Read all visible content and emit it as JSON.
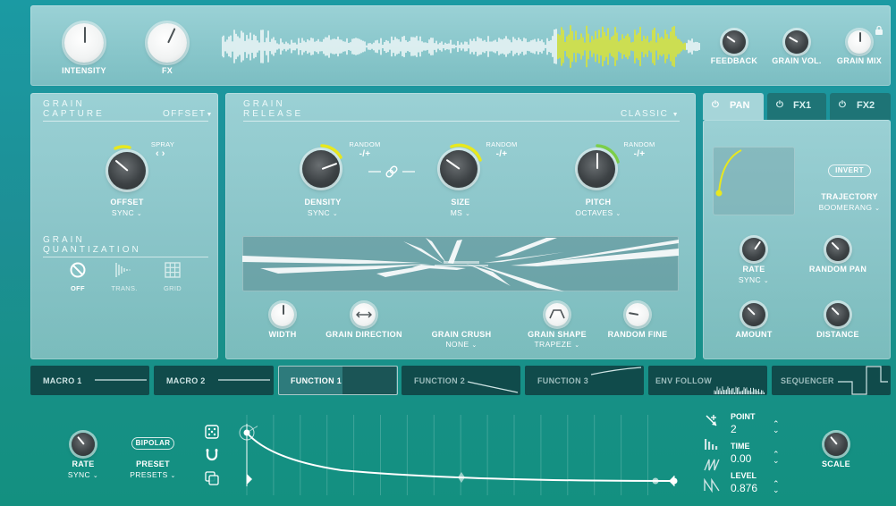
{
  "top": {
    "intensity_label": "INTENSITY",
    "fx_label": "FX",
    "feedback_label": "FEEDBACK",
    "grain_vol_label": "GRAIN VOL.",
    "grain_mix_label": "GRAIN MIX"
  },
  "capture": {
    "title1": "GRAIN",
    "title2": "CAPTURE",
    "mode": "OFFSET",
    "spray_label": "SPRAY",
    "offset_label": "OFFSET",
    "offset_sub": "SYNC"
  },
  "quantization": {
    "title1": "GRAIN",
    "title2": "QUANTIZATION",
    "options": [
      "OFF",
      "TRANS.",
      "GRID"
    ]
  },
  "release": {
    "title1": "GRAIN",
    "title2": "RELEASE",
    "mode": "CLASSIC",
    "random_label": "RANDOM",
    "random_value": "-/+",
    "density_label": "DENSITY",
    "density_sub": "SYNC",
    "size_label": "SIZE",
    "size_sub": "MS",
    "pitch_label": "PITCH",
    "pitch_sub": "OCTAVES",
    "width_label": "WIDTH",
    "direction_label": "GRAIN DIRECTION",
    "crush_label": "GRAIN CRUSH",
    "crush_sub": "NONE",
    "shape_label": "GRAIN SHAPE",
    "shape_sub": "TRAPEZE",
    "random_fine_label": "RANDOM FINE"
  },
  "fx_tabs": [
    "PAN",
    "FX1",
    "FX2"
  ],
  "pan": {
    "invert_label": "INVERT",
    "trajectory_label": "TRAJECTORY",
    "trajectory_sub": "BOOMERANG",
    "rate_label": "RATE",
    "rate_sub": "SYNC",
    "random_pan_label": "RANDOM PAN",
    "amount_label": "AMOUNT",
    "distance_label": "DISTANCE"
  },
  "mod_tabs": [
    "MACRO 1",
    "MACRO 2",
    "FUNCTION 1",
    "FUNCTION 2",
    "FUNCTION 3",
    "ENV FOLLOW",
    "SEQUENCER"
  ],
  "function": {
    "bipolar_label": "BIPOLAR",
    "rate_label": "RATE",
    "rate_sub": "SYNC",
    "preset_label": "PRESET",
    "preset_sub": "PRESETS",
    "point_label": "POINT",
    "point_value": "2",
    "time_label": "TIME",
    "time_value": "0.00",
    "level_label": "LEVEL",
    "level_value": "0.876",
    "scale_label": "SCALE"
  },
  "colors": {
    "accent_yellow": "#e8e81e",
    "accent_green": "#7ccf4a",
    "dark_tab": "#0f3c3e",
    "panel": "#bfe1e4"
  }
}
